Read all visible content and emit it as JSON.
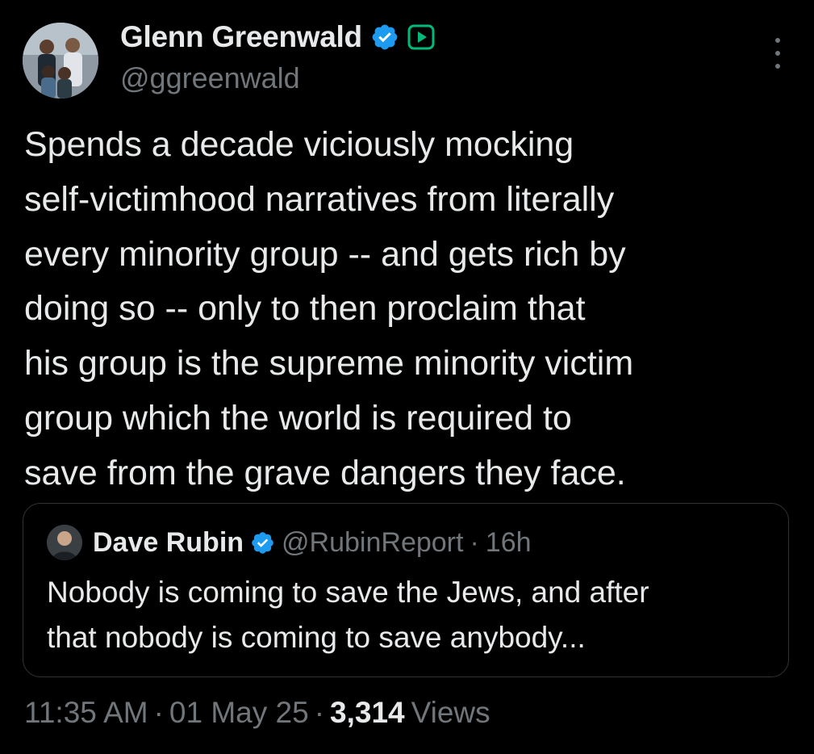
{
  "author": {
    "display_name": "Glenn Greenwald",
    "handle": "@ggreenwald",
    "verified_icon": "verified-badge-icon",
    "subscription_icon": "play-badge-icon"
  },
  "tweet": {
    "lines": [
      "Spends a decade viciously mocking",
      "self-victimhood narratives from literally",
      "every minority group -- and gets rich by",
      "doing so -- only to then proclaim that",
      "his group is the supreme minority victim",
      "group which the world is required to",
      "save from the grave dangers they face."
    ]
  },
  "quoted_tweet": {
    "display_name": "Dave Rubin",
    "handle": "@RubinReport",
    "separator": "·",
    "time": "16h",
    "lines": [
      "Nobody is coming to save the Jews, and after",
      "that nobody is coming to save anybody..."
    ]
  },
  "footer": {
    "time": "11:35 AM",
    "separator": "·",
    "date": "01 May 25",
    "views_count": "3,314",
    "views_label": "Views"
  },
  "colors": {
    "background": "#000000",
    "text_primary": "#e7e9ea",
    "text_secondary": "#71767b",
    "verified_blue": "#1d9bf0",
    "border": "#2f3336"
  }
}
